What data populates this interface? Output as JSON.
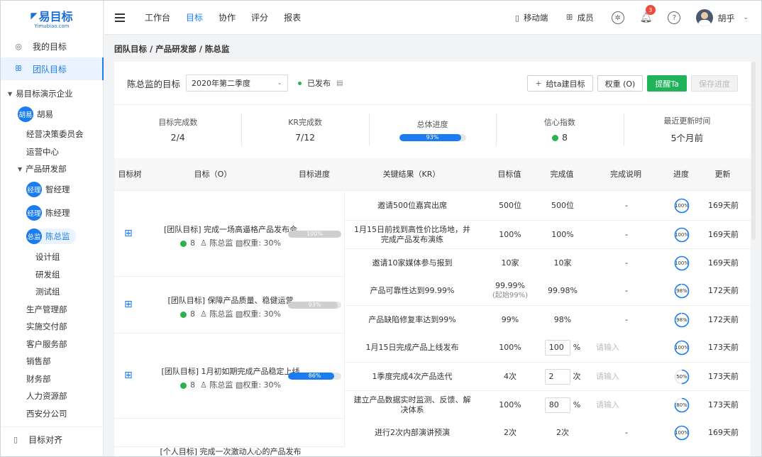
{
  "logo": {
    "main": "易目标",
    "sub": "Yimubiao.com"
  },
  "sidebar": {
    "my_goals": "我的目标",
    "team_goals": "团队目标",
    "company": "易目标演示企业",
    "tree": [
      {
        "label": "胡易",
        "avatar": "胡易"
      },
      {
        "label": "经营决策委员会"
      },
      {
        "label": "运营中心"
      },
      {
        "label": "产品研发部"
      },
      {
        "label": "智经理",
        "avatar": "经理"
      },
      {
        "label": "陈经理",
        "avatar": "经理"
      },
      {
        "label": "陈总监",
        "avatar": "总监"
      },
      {
        "label": "设计组"
      },
      {
        "label": "研发组"
      },
      {
        "label": "测试组"
      },
      {
        "label": "生产管理部"
      },
      {
        "label": "实施交付部"
      },
      {
        "label": "客户服务部"
      },
      {
        "label": "销售部"
      },
      {
        "label": "财务部"
      },
      {
        "label": "人力资源部"
      },
      {
        "label": "西安分公司"
      }
    ],
    "align": "目标对齐"
  },
  "topnav": {
    "items": [
      "工作台",
      "目标",
      "协作",
      "评分",
      "报表"
    ],
    "active": "目标",
    "mobile": "移动端",
    "members": "成员",
    "notifications": "3",
    "user": "胡乎"
  },
  "breadcrumb": "团队目标 / 产品研发部 / 陈总监",
  "header": {
    "title": "陈总监的目标",
    "period": "2020年第二季度",
    "status": "已发布",
    "buttons": {
      "add": "给ta建目标",
      "weight": "权重 (O)",
      "remind": "提醒Ta",
      "save": "保存进度"
    }
  },
  "stats": {
    "done_label": "目标完成数",
    "done_value": "2/4",
    "kr_label": "KR完成数",
    "kr_value": "7/12",
    "progress_label": "总体进度",
    "progress_value": "93%",
    "progress": 0.93,
    "confidence_label": "信心指数",
    "confidence_value": "8",
    "updated_label": "最近更新时间",
    "updated_value": "5个月前"
  },
  "columns": [
    "目标树",
    "目标（O）",
    "目标进度",
    "关键结果（KR）",
    "目标值",
    "完成值",
    "完成说明",
    "进度",
    "更新"
  ],
  "objectives": [
    {
      "title": "[团队目标] 完成一场高逼格产品发布会",
      "score": "8",
      "owner": "陈总监",
      "weight": "权重: 30%",
      "progress_label": "100%",
      "progress": 1.0,
      "bar_color": "#cfcfcf",
      "krs": [
        {
          "name": "邀请500位嘉宾出席",
          "target": "500位",
          "done": "500位",
          "note": "-",
          "ring": "100%",
          "pct": 1.0,
          "updated": "169天前"
        },
        {
          "name": "1月15日前找到高性价比场地，并完成产品发布演练",
          "target": "100%",
          "done": "100%",
          "note": "-",
          "ring": "100%",
          "pct": 1.0,
          "updated": "169天前"
        },
        {
          "name": "邀请10家媒体参与报到",
          "target": "10家",
          "done": "10家",
          "note": "-",
          "ring": "100%",
          "pct": 1.0,
          "updated": "169天前"
        }
      ]
    },
    {
      "title": "[团队目标] 保障产品质量、稳健运营",
      "score": "8",
      "owner": "陈总监",
      "weight": "权重: 30%",
      "progress_label": "93%",
      "progress": 0.93,
      "bar_color": "#cfcfcf",
      "krs": [
        {
          "name": "产品可靠性达到99.99%",
          "target": "99.99%",
          "target_sub": "(起始99%)",
          "done": "99.98%",
          "note": "-",
          "ring": "98%",
          "pct": 0.98,
          "updated": "172天前"
        },
        {
          "name": "产品缺陷修复率达到99%",
          "target": "99%",
          "done": "98%",
          "note": "-",
          "ring": "98%",
          "pct": 0.98,
          "updated": "172天前"
        }
      ]
    },
    {
      "title": "[团队目标] 1月初如期完成产品稳定上线",
      "score": "8",
      "owner": "陈总监",
      "weight": "权重: 30%",
      "progress_label": "86%",
      "progress": 0.86,
      "bar_color": "#1a7cf0",
      "krs": [
        {
          "name": "1月15日完成产品上线发布",
          "target": "100%",
          "input": "100",
          "unit": "%",
          "note_ph": "请输入",
          "ring": "100%",
          "pct": 1.0,
          "updated": "173天前"
        },
        {
          "name": "1季度完成4次产品迭代",
          "target": "4次",
          "input": "2",
          "unit": "次",
          "note_ph": "请输入",
          "ring": "50%",
          "pct": 0.5,
          "updated": "173天前"
        },
        {
          "name": "建立产品数据实时监测、反馈、解决体系",
          "target": "100%",
          "input": "80",
          "unit": "%",
          "note_ph": "请输入",
          "ring": "80%",
          "pct": 0.8,
          "updated": "173天前"
        }
      ]
    },
    {
      "title": "[个人目标] 完成一次激动人心的产品发布",
      "krs": [
        {
          "name": "进行2次内部演讲预演",
          "target": "2次",
          "done": "2次",
          "note": "-",
          "ring": "100%",
          "pct": 1.0,
          "updated": "169天前"
        }
      ]
    }
  ]
}
